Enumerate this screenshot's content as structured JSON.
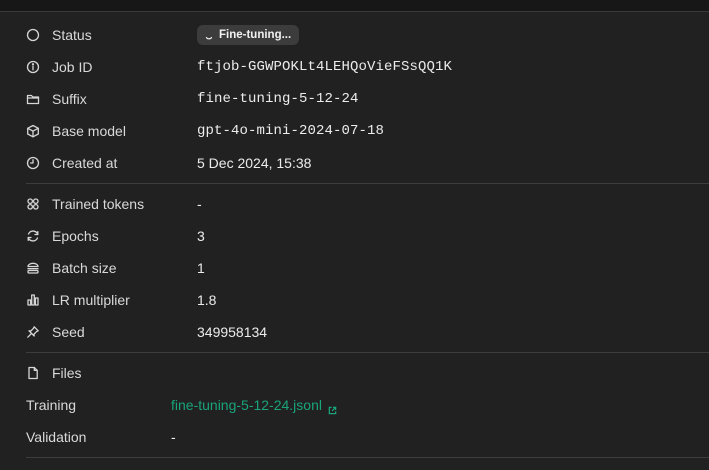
{
  "details": {
    "status": {
      "label": "Status",
      "badge": "Fine-tuning..."
    },
    "job_id": {
      "label": "Job ID",
      "value": "ftjob-GGWPOKLt4LEHQoVieFSsQQ1K"
    },
    "suffix": {
      "label": "Suffix",
      "value": "fine-tuning-5-12-24"
    },
    "base_model": {
      "label": "Base model",
      "value": "gpt-4o-mini-2024-07-18"
    },
    "created_at": {
      "label": "Created at",
      "value": "5 Dec 2024, 15:38"
    }
  },
  "hyperparameters": {
    "trained_tokens": {
      "label": "Trained tokens",
      "value": "-"
    },
    "epochs": {
      "label": "Epochs",
      "value": "3"
    },
    "batch_size": {
      "label": "Batch size",
      "value": "1"
    },
    "lr_multiplier": {
      "label": "LR multiplier",
      "value": "1.8"
    },
    "seed": {
      "label": "Seed",
      "value": "349958134"
    }
  },
  "files": {
    "title": "Files",
    "training": {
      "label": "Training",
      "value": "fine-tuning-5-12-24.jsonl"
    },
    "validation": {
      "label": "Validation",
      "value": "-"
    }
  },
  "colors": {
    "background": "#212121",
    "link": "#19a47a",
    "badge": "#3c3c3c"
  }
}
